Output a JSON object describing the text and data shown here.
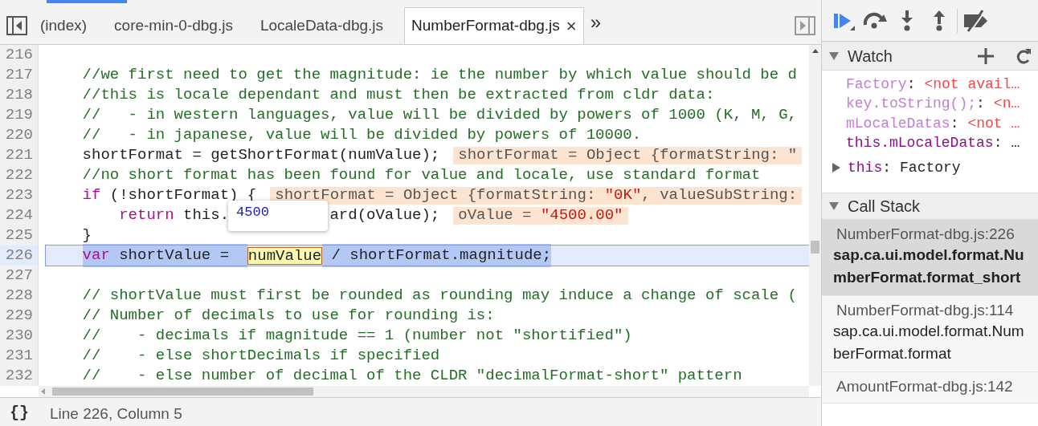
{
  "tabs": [
    {
      "label": "(index)",
      "selected": false,
      "closable": false
    },
    {
      "label": "core-min-0-dbg.js",
      "selected": false,
      "closable": false
    },
    {
      "label": "LocaleData-dbg.js",
      "selected": false,
      "closable": false
    },
    {
      "label": "NumberFormat-dbg.js",
      "selected": true,
      "closable": true
    }
  ],
  "more_tabs": "»",
  "close_glyph": "×",
  "editor": {
    "lines": [
      {
        "number": "216",
        "current": false
      },
      {
        "number": "217",
        "current": false,
        "segments": [
          {
            "kind": "comment",
            "text": "//we first need to get the magnitude: ie the number by which value should be d"
          }
        ]
      },
      {
        "number": "218",
        "current": false,
        "segments": [
          {
            "kind": "comment",
            "text": "//this is locale dependant and must then be extracted from cldr data:"
          }
        ]
      },
      {
        "number": "219",
        "current": false,
        "segments": [
          {
            "kind": "comment",
            "text": "//   - in western languages, value will be divided by powers of 1000 (K, M, G,"
          }
        ]
      },
      {
        "number": "220",
        "current": false,
        "segments": [
          {
            "kind": "comment",
            "text": "//   - in japanese, value will be divided by powers of 10000."
          }
        ]
      },
      {
        "number": "221",
        "current": false,
        "segments": [
          {
            "kind": "plain",
            "text": "shortFormat = getShortFormat(numValue);"
          }
        ],
        "inline_value": [
          {
            "kind": "plain",
            "text": "shortFormat = Object {formatString: \""
          }
        ]
      },
      {
        "number": "222",
        "current": false,
        "segments": [
          {
            "kind": "comment",
            "text": "//no short format has been found for value and locale, use standard format"
          }
        ]
      },
      {
        "number": "223",
        "current": false,
        "segments": [
          {
            "kind": "keyword",
            "text": "if"
          },
          {
            "kind": "plain",
            "text": " (!shortFormat) {"
          }
        ],
        "inline_value": [
          {
            "kind": "plain",
            "text": "shortFormat = Object {formatString: "
          },
          {
            "kind": "string",
            "text": "\"0K\""
          },
          {
            "kind": "plain",
            "text": ", valueSubString:"
          }
        ]
      },
      {
        "number": "224",
        "nested": true,
        "current": false,
        "segments": [
          {
            "kind": "keyword",
            "text": "return"
          },
          {
            "kind": "plain",
            "text": " this."
          },
          {
            "kind": "gap",
            "tooltip": "4500"
          },
          {
            "kind": "plain",
            "text": "ard(oValue);"
          }
        ],
        "inline_value": [
          {
            "kind": "plain",
            "text": "oValue = "
          },
          {
            "kind": "string",
            "text": "\"4500.00\""
          }
        ]
      },
      {
        "number": "225",
        "current": false,
        "segments": [
          {
            "kind": "plain",
            "text": "}"
          }
        ]
      },
      {
        "number": "226",
        "current": true,
        "segments": [
          {
            "kind": "keyword",
            "text": "var"
          },
          {
            "kind": "plain",
            "text": " shortValue =  "
          },
          {
            "kind": "hovered",
            "text": "numValue"
          },
          {
            "kind": "plain",
            "text": " / shortFormat.magnitude;"
          }
        ]
      },
      {
        "number": "227",
        "current": false
      },
      {
        "number": "228",
        "current": false,
        "segments": [
          {
            "kind": "comment",
            "text": "// shortValue must first be rounded as rounding may induce a change of scale ("
          }
        ]
      },
      {
        "number": "229",
        "current": false,
        "segments": [
          {
            "kind": "comment",
            "text": "// Number of decimals to use for rounding is:"
          }
        ]
      },
      {
        "number": "230",
        "current": false,
        "segments": [
          {
            "kind": "comment",
            "text": "//    - decimals if magnitude == 1 (number not \"shortified\")"
          }
        ]
      },
      {
        "number": "231",
        "current": false,
        "segments": [
          {
            "kind": "comment",
            "text": "//    - else shortDecimals if specified"
          }
        ]
      },
      {
        "number": "232",
        "current": false,
        "segments": [
          {
            "kind": "comment",
            "text": "//    - else number of decimal of the CLDR \"decimalFormat-short\" pattern"
          }
        ]
      }
    ]
  },
  "status_bar": {
    "format_glyph": "{}",
    "position": "Line 226, Column 5"
  },
  "watch": {
    "title": "Watch",
    "expanded": true,
    "items": [
      {
        "name": "Factory",
        "separator": ":",
        "value": "<not avail…",
        "available": false
      },
      {
        "name": "key.toString();",
        "separator": ":",
        "value": "<n…",
        "available": false
      },
      {
        "name": "mLocaleDatas",
        "separator": ":",
        "value": "<not …",
        "available": false
      },
      {
        "name": "this.mLocaleDatas",
        "separator": ":",
        "value": "…",
        "available": true
      }
    ],
    "scope": {
      "name": "this",
      "separator": ":",
      "value": "Factory",
      "expanded": false
    }
  },
  "call_stack": {
    "title": "Call Stack",
    "expanded": true,
    "frames": [
      {
        "location": "NumberFormat-dbg.js:226",
        "function": "sap.ca.ui.model.format.NumberFormat.format_short",
        "selected": true
      },
      {
        "location": "NumberFormat-dbg.js:114",
        "function": "sap.ca.ui.model.format.NumberFormat.format",
        "selected": false
      },
      {
        "location": "AmountFormat-dbg.js:142",
        "selected": false
      }
    ]
  }
}
